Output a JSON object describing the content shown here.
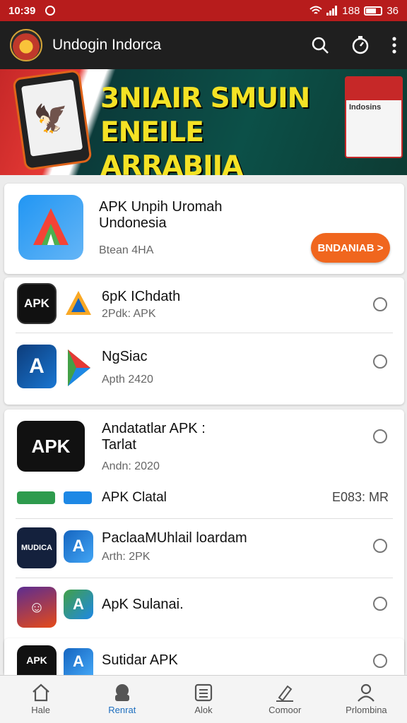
{
  "status_bar": {
    "time": "10:39",
    "battery_text": "188",
    "battery_level": "36"
  },
  "app_bar": {
    "title": "Undogin Indorca"
  },
  "banner": {
    "headline_line1": "3NIAIR SMUIN",
    "headline_line2": "ENEILE ARRABIIA",
    "box_text": "Indosins"
  },
  "featured": {
    "title_line1": "APK Unpih Uromah",
    "title_line2": "Undonesia",
    "subtitle": "Btean 4HA",
    "button_label": "BNDANIAB >"
  },
  "group1": [
    {
      "icon1_text": "APK",
      "title": "6pK IChdath",
      "subtitle": "2Pdk: APK"
    },
    {
      "icon1_text": "A",
      "title": "NgSiac",
      "subtitle": "Apth 2420"
    }
  ],
  "group2": {
    "feature_title_line1": "Andatatlar APK :",
    "feature_title_line2": "Tarlat",
    "feature_subtitle": "Andn: 2020",
    "banner_row": {
      "title": "APK Clatal",
      "size": "E083: MR"
    },
    "rows": [
      {
        "icon1_text": "MUDICA",
        "title": "PaclaaMUhlail loardam",
        "subtitle": "Arth: 2PK"
      },
      {
        "icon1_text": "",
        "title": "ApK Sulanai.",
        "subtitle": ""
      },
      {
        "icon1_text": "APK",
        "title": "Sutidar APK",
        "subtitle": ""
      }
    ]
  },
  "bottom_nav": [
    {
      "label": "Hale",
      "icon": "home-icon",
      "active": false
    },
    {
      "label": "Renrat",
      "icon": "robot-icon",
      "active": true
    },
    {
      "label": "Alok",
      "icon": "list-icon",
      "active": false
    },
    {
      "label": "Comoor",
      "icon": "edit-icon",
      "active": false
    },
    {
      "label": "Prlombina",
      "icon": "profile-icon",
      "active": false
    }
  ],
  "colors": {
    "status_bar": "#b71c1c",
    "app_bar": "#1f1f1f",
    "accent": "#f0661e",
    "nav_active": "#1e6fbf"
  }
}
